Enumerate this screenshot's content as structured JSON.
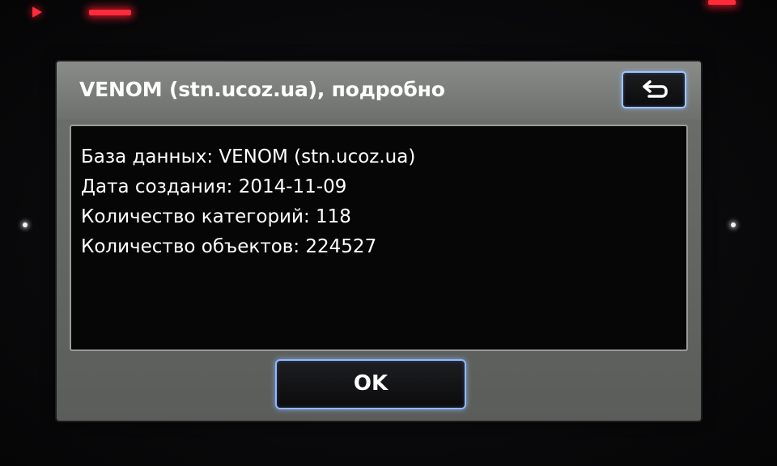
{
  "dialog": {
    "title": "VENOM (stn.ucoz.ua), подробно",
    "back_icon": "return-arrow-icon",
    "details": [
      "База данных: VENOM (stn.ucoz.ua)",
      "Дата создания: 2014-11-09",
      "Количество категорий: 118",
      "Количество объектов: 224527"
    ],
    "ok_label": "OK"
  },
  "colors": {
    "accent_border": "#8fb8ff",
    "title_bar": "#7c7e7b",
    "panel_background": "#060607",
    "bezel_light": "#ff2a3a"
  }
}
